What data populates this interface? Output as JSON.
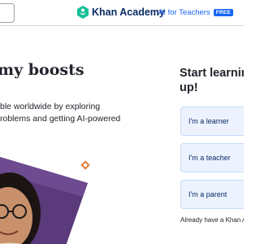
{
  "header": {
    "brand_name": "Khan Academy",
    "ai_for_teachers": "AI for Teachers",
    "free_badge": "FREE"
  },
  "hero": {
    "heading": "my boosts",
    "body_line1": "ble worldwide by exploring",
    "body_line2": "roblems and getting AI-powered"
  },
  "signup": {
    "title_line1": "Start learning",
    "title_line2": "up!",
    "roles": [
      "I'm a learner",
      "I'm a teacher",
      "I'm a parent"
    ],
    "have_account": "Already have a Khan A"
  },
  "colors": {
    "brand_green": "#14bf96",
    "brand_navy": "#0a2a66",
    "link_blue": "#1865f2",
    "photo_purple": "#5a3a7a",
    "accent_orange": "#e07a3a",
    "role_button_bg": "#ecf3fe"
  },
  "icons": [
    "search-icon",
    "khan-academy-logo-icon"
  ]
}
